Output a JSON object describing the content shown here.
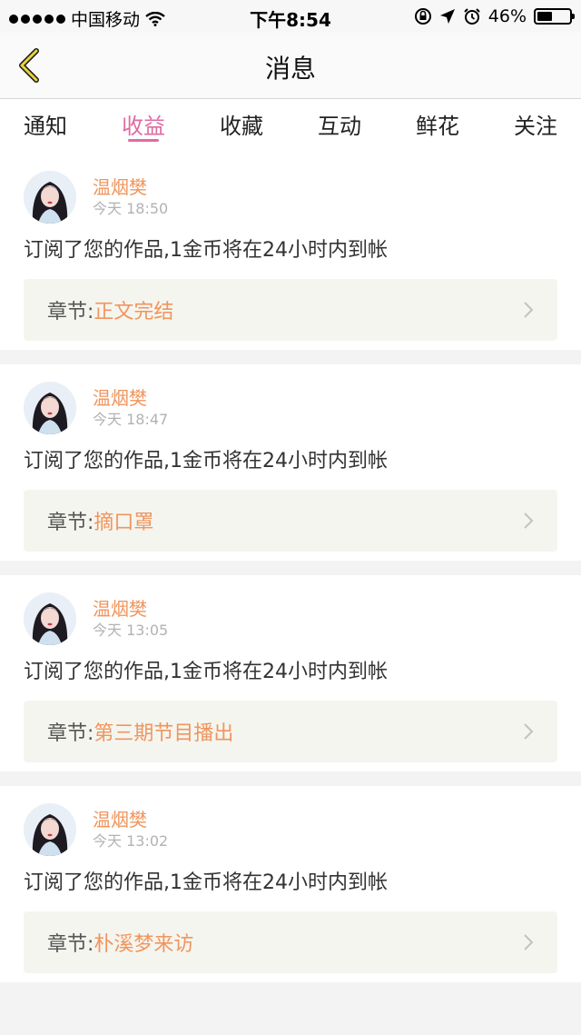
{
  "status_bar": {
    "carrier": "中国移动",
    "time": "下午8:54",
    "battery_percent": "46%",
    "battery_level": 0.46
  },
  "navbar": {
    "back_icon": "chevron-left-icon",
    "title": "消息"
  },
  "tabs": [
    {
      "label": "通知"
    },
    {
      "label": "收益",
      "active": true
    },
    {
      "label": "收藏"
    },
    {
      "label": "互动"
    },
    {
      "label": "鲜花"
    },
    {
      "label": "关注"
    }
  ],
  "colors": {
    "accent": "#e06ba3",
    "name_orange": "#f0955e",
    "chapter_bg": "#f5f5ef"
  },
  "messages": [
    {
      "user": "温烟樊",
      "time": "今天 18:50",
      "text": "订阅了您的作品,1金币将在24小时内到帐",
      "chapter_label": "章节:",
      "chapter": "正文完结"
    },
    {
      "user": "温烟樊",
      "time": "今天 18:47",
      "text": "订阅了您的作品,1金币将在24小时内到帐",
      "chapter_label": "章节:",
      "chapter": "摘口罩"
    },
    {
      "user": "温烟樊",
      "time": "今天 13:05",
      "text": "订阅了您的作品,1金币将在24小时内到帐",
      "chapter_label": "章节:",
      "chapter": "第三期节目播出"
    },
    {
      "user": "温烟樊",
      "time": "今天 13:02",
      "text": "订阅了您的作品,1金币将在24小时内到帐",
      "chapter_label": "章节:",
      "chapter": "朴溪梦来访"
    }
  ]
}
